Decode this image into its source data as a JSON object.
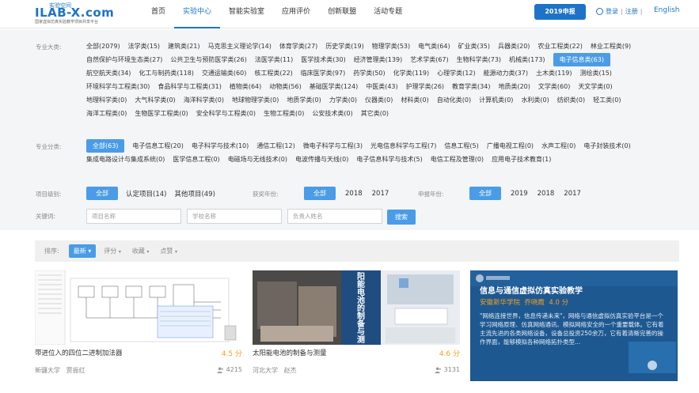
{
  "header": {
    "logo_top": "实验空间",
    "logo_main": "ILAB-X.com",
    "logo_sub": "国家虚拟仿真实验教学项目共享平台",
    "nav": [
      "首页",
      "实验中心",
      "智能实验室",
      "应用评价",
      "创新联盟",
      "活动专题"
    ],
    "apply_button": "2019申报",
    "login": "登录",
    "register": "注册",
    "language": "English"
  },
  "filter": {
    "major_label": "专业大类:",
    "major_tags": [
      "全部(2079)",
      "法学类(15)",
      "建筑类(21)",
      "马克思主义理论学(14)",
      "体育学类(27)",
      "历史学类(19)",
      "物理学类(53)",
      "电气类(64)",
      "矿业类(35)",
      "兵器类(20)",
      "农业工程类(22)",
      "林业工程类(9)",
      "自然保护与环境生态类(27)",
      "公共卫生与预防医学类(26)",
      "法医学类(11)",
      "医学技术类(30)",
      "经济管理类(139)",
      "艺术学类(67)",
      "生物科学类(73)",
      "机械类(173)",
      "电子信息类(63)",
      "航空航天类(34)",
      "化工与制药类(118)",
      "交通运输类(60)",
      "核工程类(22)",
      "临床医学类(97)",
      "药学类(50)",
      "化学类(119)",
      "心理学类(12)",
      "能源动力类(37)",
      "土木类(119)",
      "测绘类(15)",
      "环境科学与工程类(30)",
      "食品科学与工程类(31)",
      "植物类(64)",
      "动物类(56)",
      "基础医学类(124)",
      "中医类(43)",
      "护理学类(26)",
      "教育学类(34)",
      "地质类(20)",
      "文学类(60)",
      "天文学类(0)",
      "地理科学类(0)",
      "大气科学类(0)",
      "海洋科学类(0)",
      "地球物理学类(0)",
      "地质学类(0)",
      "力学类(0)",
      "仪器类(0)",
      "材料类(0)",
      "自动化类(0)",
      "计算机类(0)",
      "水利类(0)",
      "纺织类(0)",
      "轻工类(0)",
      "海洋工程类(0)",
      "生物医学工程类(0)",
      "安全科学与工程类(0)",
      "生物工程类(0)",
      "公安技术类(0)",
      "其它类(0)"
    ],
    "major_active_index": 20,
    "category_label": "专业分类:",
    "category_tags": [
      "全部(63)",
      "电子信息工程(20)",
      "电子科学与技术(10)",
      "通信工程(12)",
      "微电子科学与工程(3)",
      "光电信息科学与工程(7)",
      "信息工程(5)",
      "广播电视工程(0)",
      "水声工程(0)",
      "电子封装技术(0)",
      "集成电路设计与集成系统(0)",
      "医学信息工程(0)",
      "电磁场与无线技术(0)",
      "电波传播与天线(0)",
      "电子信息科学与技术(5)",
      "电信工程及管理(0)",
      "应用电子技术教育(1)"
    ],
    "level_label": "项目级别:",
    "level_all": "全部",
    "level_items": [
      "认定项目(14)",
      "其他项目(49)"
    ],
    "award_label": "获奖年份:",
    "award_all": "全部",
    "award_years": [
      "2018",
      "2017"
    ],
    "apply_label": "申报年份:",
    "apply_all": "全部",
    "apply_years": [
      "2019",
      "2018",
      "2017"
    ],
    "keyword_label": "关键词:",
    "placeholder_project": "项目名称",
    "placeholder_school": "学校名称",
    "placeholder_person": "负责人姓名",
    "search_button": "搜索"
  },
  "sort": {
    "label": "排序:",
    "active": "最新",
    "items": [
      "评分",
      "收藏",
      "点赞"
    ]
  },
  "cards": [
    {
      "title": "带进位入的四位二进制加法器",
      "rating": "4.5 分",
      "school": "新疆大学",
      "person": "贾振红",
      "views": "4215"
    },
    {
      "title": "太阳能电池的制备与测量",
      "rating": "4.6 分",
      "school": "河北大学",
      "person": "赵杰",
      "views": "3131",
      "image_text": [
        "阳",
        "能",
        "电",
        "池",
        "的",
        "制",
        "备",
        "与",
        "测"
      ]
    },
    {
      "title": "信息与通信虚拟仿真实验教学",
      "subtitle_line": "安徽新华学院",
      "subtitle_person": "乔晓霞",
      "rating_overlay": "4.0 分",
      "desc": "\"网络连接世界，信息传递未来\"，网络与通信虚拟仿真实验平台是一个学习网络原理、仿真网络通讯、模拟网络安全的一个重要载体。它有着主流先进的各类网络设备，设备总投资250余万，它有着清晰完善的操作界面，能够模拟各种网络拓扑类型..."
    }
  ],
  "colors": {
    "accent": "#1e73c8",
    "pill": "#4a9ce6",
    "rating": "#f0a020"
  }
}
